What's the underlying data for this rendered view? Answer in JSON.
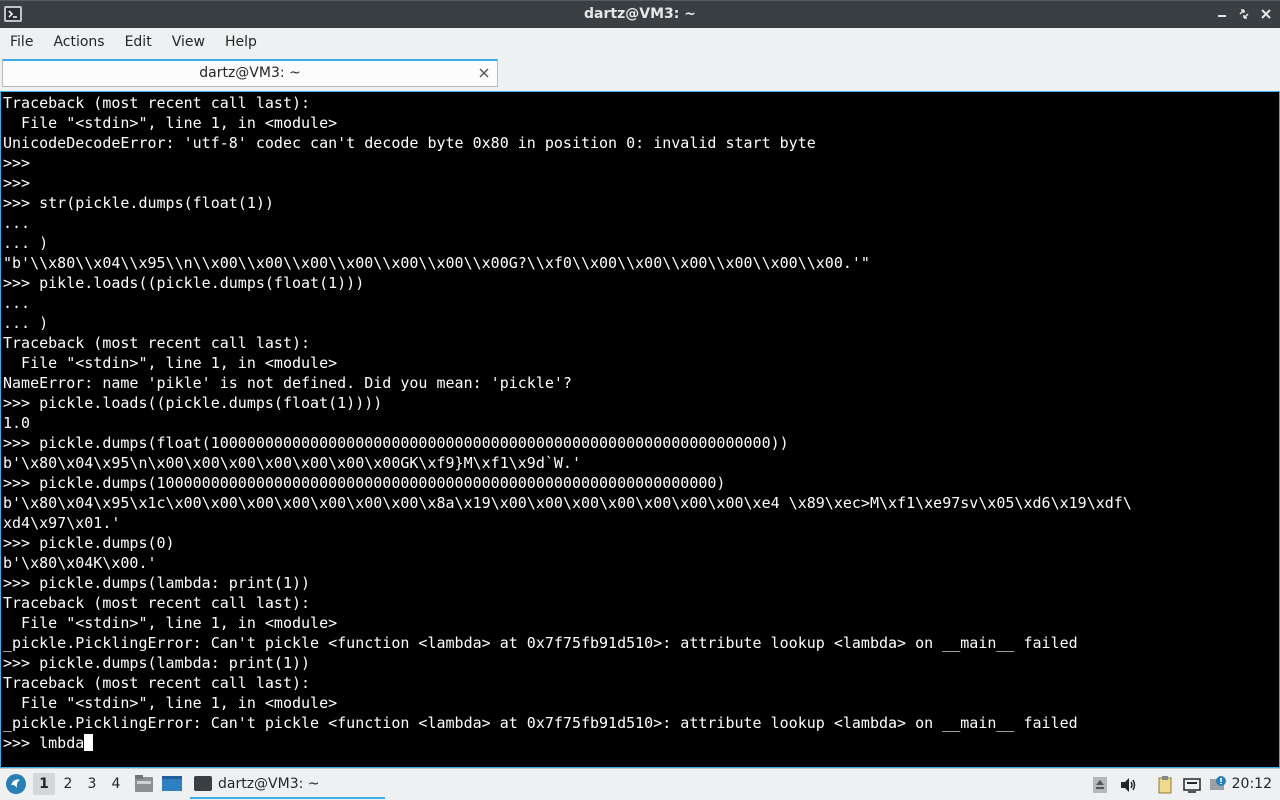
{
  "window": {
    "title": "dartz@VM3: ~"
  },
  "menu": {
    "items": [
      "File",
      "Actions",
      "Edit",
      "View",
      "Help"
    ]
  },
  "tab": {
    "label": "dartz@VM3: ~"
  },
  "terminal": {
    "lines": [
      "Traceback (most recent call last):",
      "  File \"<stdin>\", line 1, in <module>",
      "UnicodeDecodeError: 'utf-8' codec can't decode byte 0x80 in position 0: invalid start byte",
      ">>>",
      ">>>",
      ">>> str(pickle.dumps(float(1))",
      "...",
      "... )",
      "\"b'\\\\x80\\\\x04\\\\x95\\\\n\\\\x00\\\\x00\\\\x00\\\\x00\\\\x00\\\\x00\\\\x00G?\\\\xf0\\\\x00\\\\x00\\\\x00\\\\x00\\\\x00\\\\x00.'\"",
      ">>> pikle.loads((pickle.dumps(float(1)))",
      "...",
      "... )",
      "Traceback (most recent call last):",
      "  File \"<stdin>\", line 1, in <module>",
      "NameError: name 'pikle' is not defined. Did you mean: 'pickle'?",
      ">>> pickle.loads((pickle.dumps(float(1))))",
      "1.0",
      ">>> pickle.dumps(float(10000000000000000000000000000000000000000000000000000000000000))",
      "b'\\x80\\x04\\x95\\n\\x00\\x00\\x00\\x00\\x00\\x00\\x00GK\\xf9}M\\xf1\\x9d`W.'",
      ">>> pickle.dumps(10000000000000000000000000000000000000000000000000000000000000)",
      "b'\\x80\\x04\\x95\\x1c\\x00\\x00\\x00\\x00\\x00\\x00\\x00\\x8a\\x19\\x00\\x00\\x00\\x00\\x00\\x00\\x00\\xe4 \\x89\\xec>M\\xf1\\xe97sv\\x05\\xd6\\x19\\xdf\\",
      "xd4\\x97\\x01.'",
      ">>> pickle.dumps(0)",
      "b'\\x80\\x04K\\x00.'",
      ">>> pickle.dumps(lambda: print(1))",
      "Traceback (most recent call last):",
      "  File \"<stdin>\", line 1, in <module>",
      "_pickle.PicklingError: Can't pickle <function <lambda> at 0x7f75fb91d510>: attribute lookup <lambda> on __main__ failed",
      ">>> pickle.dumps(lambda: print(1))",
      "Traceback (most recent call last):",
      "  File \"<stdin>\", line 1, in <module>",
      "_pickle.PicklingError: Can't pickle <function <lambda> at 0x7f75fb91d510>: attribute lookup <lambda> on __main__ failed"
    ],
    "prompt_line": ">>> lmbda"
  },
  "taskbar": {
    "desktops": [
      "1",
      "2",
      "3",
      "4"
    ],
    "active_desktop": "1",
    "task_label": "dartz@VM3: ~",
    "clock": "20:12"
  },
  "colors": {
    "accent": "#3daee9",
    "titlebar": "#3a3f44",
    "terminal_bg": "#000000",
    "terminal_fg": "#ffffff"
  }
}
